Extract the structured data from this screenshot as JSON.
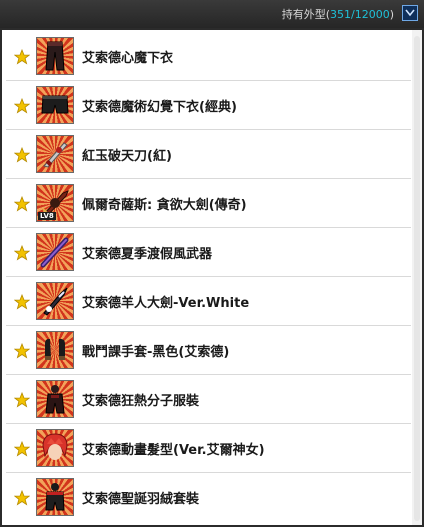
{
  "header": {
    "owned_label": "持有外型(",
    "owned_count": "351/12000",
    "owned_suffix": ")",
    "chevron_icon": "chevron-down-icon"
  },
  "colors": {
    "accent": "#1fc0d8",
    "star": "#f2c200",
    "thumb_bg_dark": "#d2341c",
    "thumb_bg_light": "#f2a35a"
  },
  "items": [
    {
      "name": "艾索德心魔下衣",
      "icon": "dark-pants-icon"
    },
    {
      "name": "艾索德魔術幻覺下衣(經典)",
      "icon": "black-shorts-icon"
    },
    {
      "name": "紅玉破天刀(紅)",
      "icon": "red-blade-icon"
    },
    {
      "name": "佩爾奇薩斯: 貪欲大劍(傳奇)",
      "icon": "greatsword-icon",
      "badge": "LV8"
    },
    {
      "name": "艾索德夏季渡假風武器",
      "icon": "purple-staff-icon"
    },
    {
      "name": "艾索德羊人大劍-Ver.White",
      "icon": "sword-icon"
    },
    {
      "name": "戰鬥課手套-黑色(艾索德)",
      "icon": "gloves-icon"
    },
    {
      "name": "艾索德狂熱分子服裝",
      "icon": "outfit-icon"
    },
    {
      "name": "艾索德動畫髮型(Ver.艾爾神女)",
      "icon": "red-hair-icon"
    },
    {
      "name": "艾索德聖誕羽絨套裝",
      "icon": "winter-suit-icon"
    }
  ]
}
